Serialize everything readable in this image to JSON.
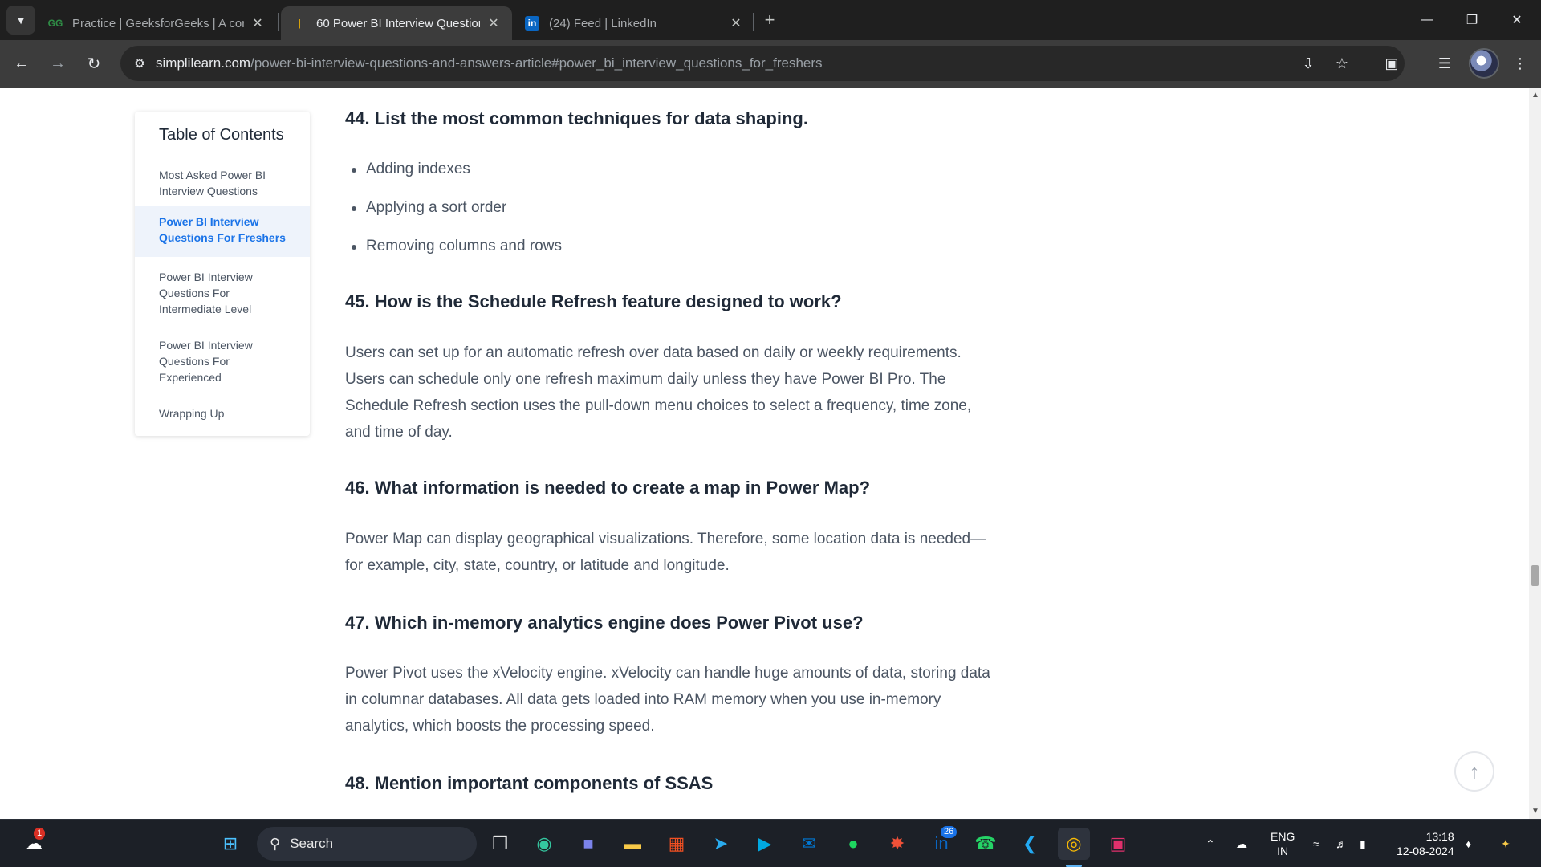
{
  "browser": {
    "tabs": [
      {
        "favicon": "geeksforgeeks-icon",
        "label": "Practice | GeeksforGeeks | A com",
        "active": false
      },
      {
        "favicon": "simplilearn-icon",
        "label": "60 Power BI Interview Questions",
        "active": true
      },
      {
        "favicon": "linkedin-icon",
        "label": "(24) Feed | LinkedIn",
        "active": false
      }
    ],
    "url_domain": "simplilearn.com",
    "url_path": "/power-bi-interview-questions-and-answers-article#power_bi_interview_questions_for_freshers"
  },
  "toc": {
    "title": "Table of Contents",
    "items": [
      {
        "label": "Most Asked Power BI Interview Questions",
        "active": false
      },
      {
        "label": "Power BI Interview Questions For Freshers",
        "active": true
      },
      {
        "label": "Power BI Interview Questions For Intermediate Level",
        "active": false
      },
      {
        "label": "Power BI Interview Questions For Experienced",
        "active": false
      },
      {
        "label": "Wrapping Up",
        "active": false
      }
    ]
  },
  "article": {
    "q44": {
      "title": "44. List the most common techniques for data shaping.",
      "bullets": [
        "Adding indexes",
        "Applying a sort order",
        "Removing columns and rows"
      ]
    },
    "q45": {
      "title": "45. How is the Schedule Refresh feature designed to work?",
      "body": "Users can set up for an automatic refresh over data based on daily or weekly requirements. Users can schedule only one refresh maximum daily unless they have Power BI Pro. The Schedule Refresh section uses the pull-down menu choices to select a frequency, time zone, and time of day."
    },
    "q46": {
      "title": "46. What information is needed to create a map in Power Map?",
      "body": "Power Map can display geographical visualizations. Therefore, some location data is needed—for example, city, state, country, or latitude and longitude."
    },
    "q47": {
      "title": "47. Which in-memory analytics engine does Power Pivot use?",
      "body": "Power Pivot uses the xVelocity engine. xVelocity can handle huge amounts of data, storing data in columnar databases. All data gets loaded into RAM memory when you use in-memory analytics, which boosts the processing speed."
    },
    "q48": {
      "title": "48. Mention important components of SSAS"
    }
  },
  "taskbar": {
    "search_label": "Search",
    "weather_badge": "1",
    "linkedin_badge": "26",
    "language": "ENG",
    "region": "IN",
    "time": "13:18",
    "date": "12-08-2024",
    "apps": [
      "weather-icon",
      "start-icon",
      "task-view-icon",
      "edge-icon",
      "teams-icon",
      "file-explorer-icon",
      "store-icon",
      "telegram-icon",
      "prime-video-icon",
      "outlook-icon",
      "spotify-icon",
      "swift-icon",
      "linkedin-app-icon",
      "whatsapp-icon",
      "vscode-icon",
      "chrome-icon",
      "instagram-icon"
    ]
  },
  "colors": {
    "accent": "#1a73e8",
    "heading": "#1f2937",
    "body_text": "#4b5563",
    "toc_active_bg": "#eef3fb"
  }
}
